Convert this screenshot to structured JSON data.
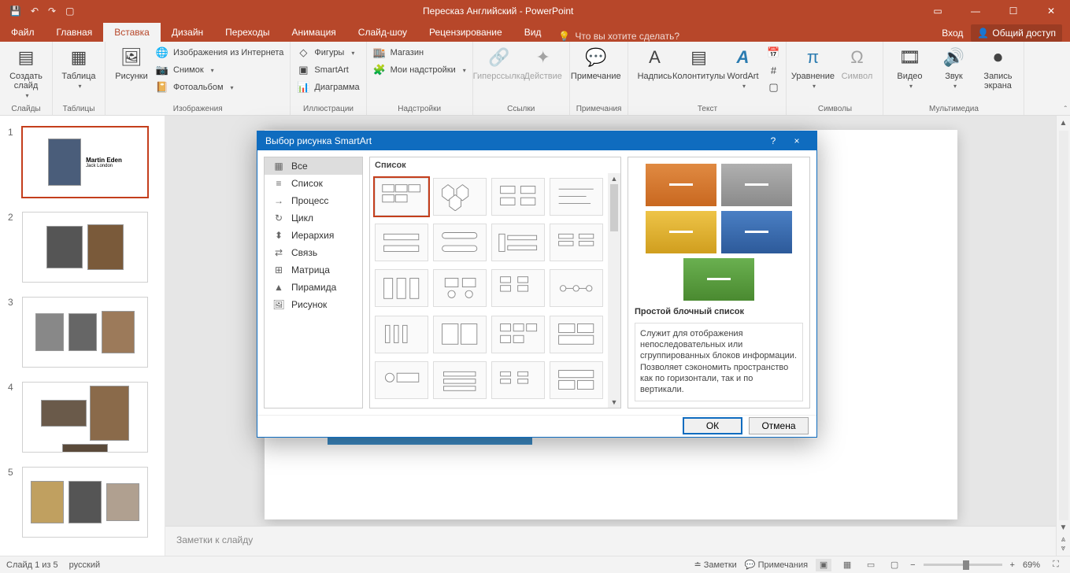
{
  "title": "Пересказ Английский - PowerPoint",
  "tabs": {
    "file": "Файл",
    "home": "Главная",
    "insert": "Вставка",
    "design": "Дизайн",
    "transitions": "Переходы",
    "animations": "Анимация",
    "slideshow": "Слайд-шоу",
    "review": "Рецензирование",
    "view": "Вид"
  },
  "tellme": "Что вы хотите сделать?",
  "signin": "Вход",
  "share": "Общий доступ",
  "groups": {
    "slides": "Слайды",
    "tables": "Таблицы",
    "images": "Изображения",
    "illustrations": "Иллюстрации",
    "addins": "Надстройки",
    "links": "Ссылки",
    "comments": "Примечания",
    "text": "Текст",
    "symbols": "Символы",
    "media": "Мультимедиа"
  },
  "cmds": {
    "newSlide": "Создать слайд",
    "table": "Таблица",
    "pictures": "Рисунки",
    "onlinePictures": "Изображения из Интернета",
    "screenshot": "Снимок",
    "photoAlbum": "Фотоальбом",
    "shapes": "Фигуры",
    "smartart": "SmartArt",
    "chart": "Диаграмма",
    "store": "Магазин",
    "myAddins": "Мои надстройки",
    "hyperlink": "Гиперссылка",
    "action": "Действие",
    "comment": "Примечание",
    "textbox": "Надпись",
    "headerFooter": "Колонтитулы",
    "wordart": "WordArt",
    "equation": "Уравнение",
    "symbol": "Символ",
    "video": "Видео",
    "audio": "Звук",
    "screenRec": "Запись экрана"
  },
  "thumbs": {
    "slide1": {
      "title": "Martin Eden",
      "subtitle": "Jack London"
    }
  },
  "notes": "Заметки к слайду",
  "status": {
    "slide": "Слайд 1 из 5",
    "lang": "русский",
    "notesBtn": "Заметки",
    "commentsBtn": "Примечания",
    "zoom": "69%"
  },
  "dialog": {
    "title": "Выбор рисунка SmartArt",
    "help": "?",
    "close": "×",
    "cats": {
      "all": "Все",
      "list": "Список",
      "process": "Процесс",
      "cycle": "Цикл",
      "hierarchy": "Иерархия",
      "relationship": "Связь",
      "matrix": "Матрица",
      "pyramid": "Пирамида",
      "picture": "Рисунок"
    },
    "galleryTitle": "Список",
    "previewName": "Простой блочный список",
    "previewDesc": "Служит для отображения непоследовательных или сгруппированных блоков информации. Позволяет сэкономить пространство как по горизонтали, так и по вертикали.",
    "ok": "ОК",
    "cancel": "Отмена",
    "tiles": [
      {
        "bg": "#d97938"
      },
      {
        "bg": "#9c9c9c"
      },
      {
        "bg": "#e0b030"
      },
      {
        "bg": "#3a6eb5"
      },
      {
        "bg": "#5a9e46"
      }
    ]
  }
}
